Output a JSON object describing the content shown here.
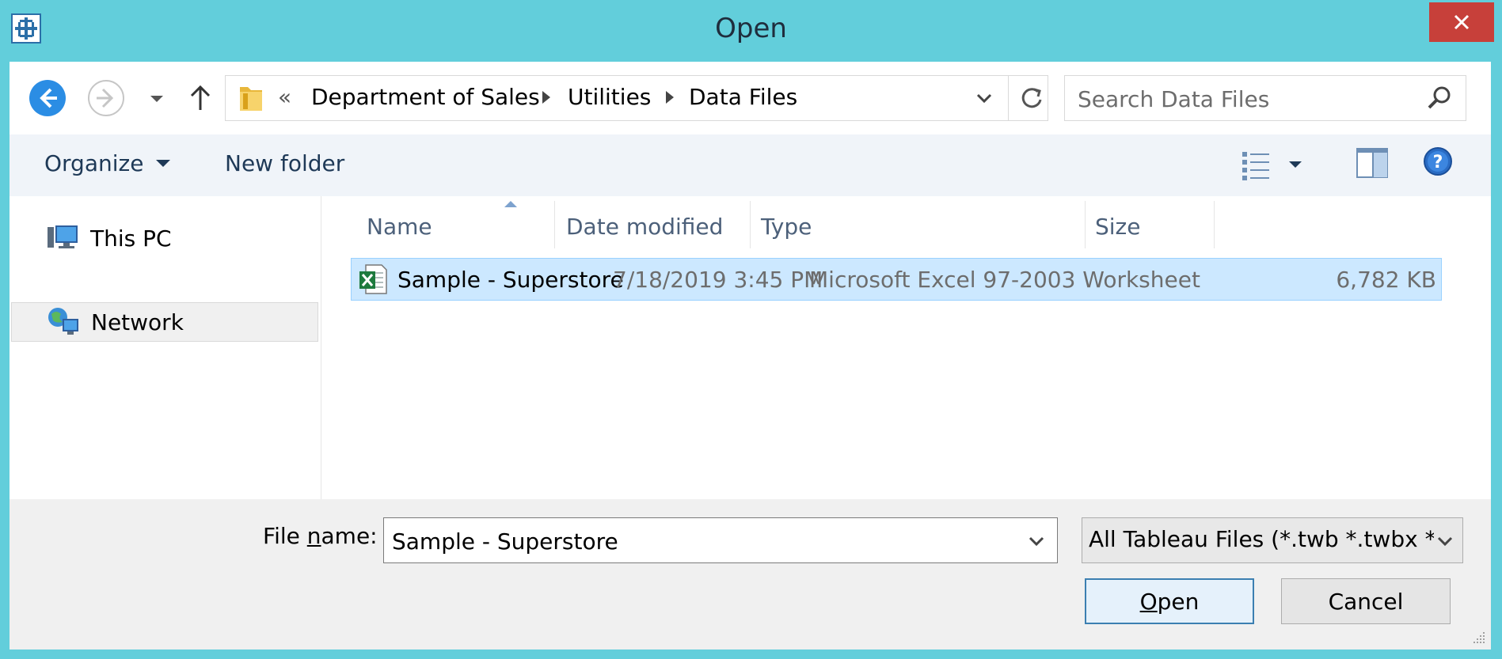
{
  "window": {
    "title": "Open",
    "close_symbol": "✕"
  },
  "navbar": {
    "back_icon": "back-arrow-icon",
    "forward_icon": "forward-arrow-icon",
    "recent_icon": "chevron-down-icon",
    "up_icon": "up-arrow-icon",
    "address": {
      "overflow": "«",
      "breadcrumbs": [
        "Department of Sales",
        "Utilities",
        "Data Files"
      ]
    },
    "search_placeholder": "Search Data Files"
  },
  "toolbar": {
    "organize_label": "Organize",
    "new_folder_label": "New folder"
  },
  "nav_pane": {
    "items": [
      {
        "label": "This PC",
        "icon": "computer-icon",
        "selected": false
      },
      {
        "label": "Network",
        "icon": "network-icon",
        "selected": true
      }
    ]
  },
  "file_list": {
    "columns": [
      "Name",
      "Date modified",
      "Type",
      "Size"
    ],
    "sorted_by": "Name",
    "rows": [
      {
        "name": "Sample - Superstore",
        "date_modified": "7/18/2019 3:45 PM",
        "type": "Microsoft Excel 97-2003 Worksheet",
        "size": "6,782 KB",
        "icon": "excel-file-icon",
        "selected": true
      }
    ]
  },
  "footer": {
    "file_name_label_pre": "File ",
    "file_name_label_key": "n",
    "file_name_label_post": "ame:",
    "file_name_value": "Sample - Superstore",
    "file_type_selected": "All Tableau Files (*.twb *.twbx *",
    "open_key": "O",
    "open_rest": "pen",
    "cancel_label": "Cancel"
  },
  "colors": {
    "frame": "#62cedb",
    "close": "#c7403a",
    "selection": "#cce8ff",
    "selection_border": "#99d1ff",
    "accent": "#3c7fb1"
  }
}
